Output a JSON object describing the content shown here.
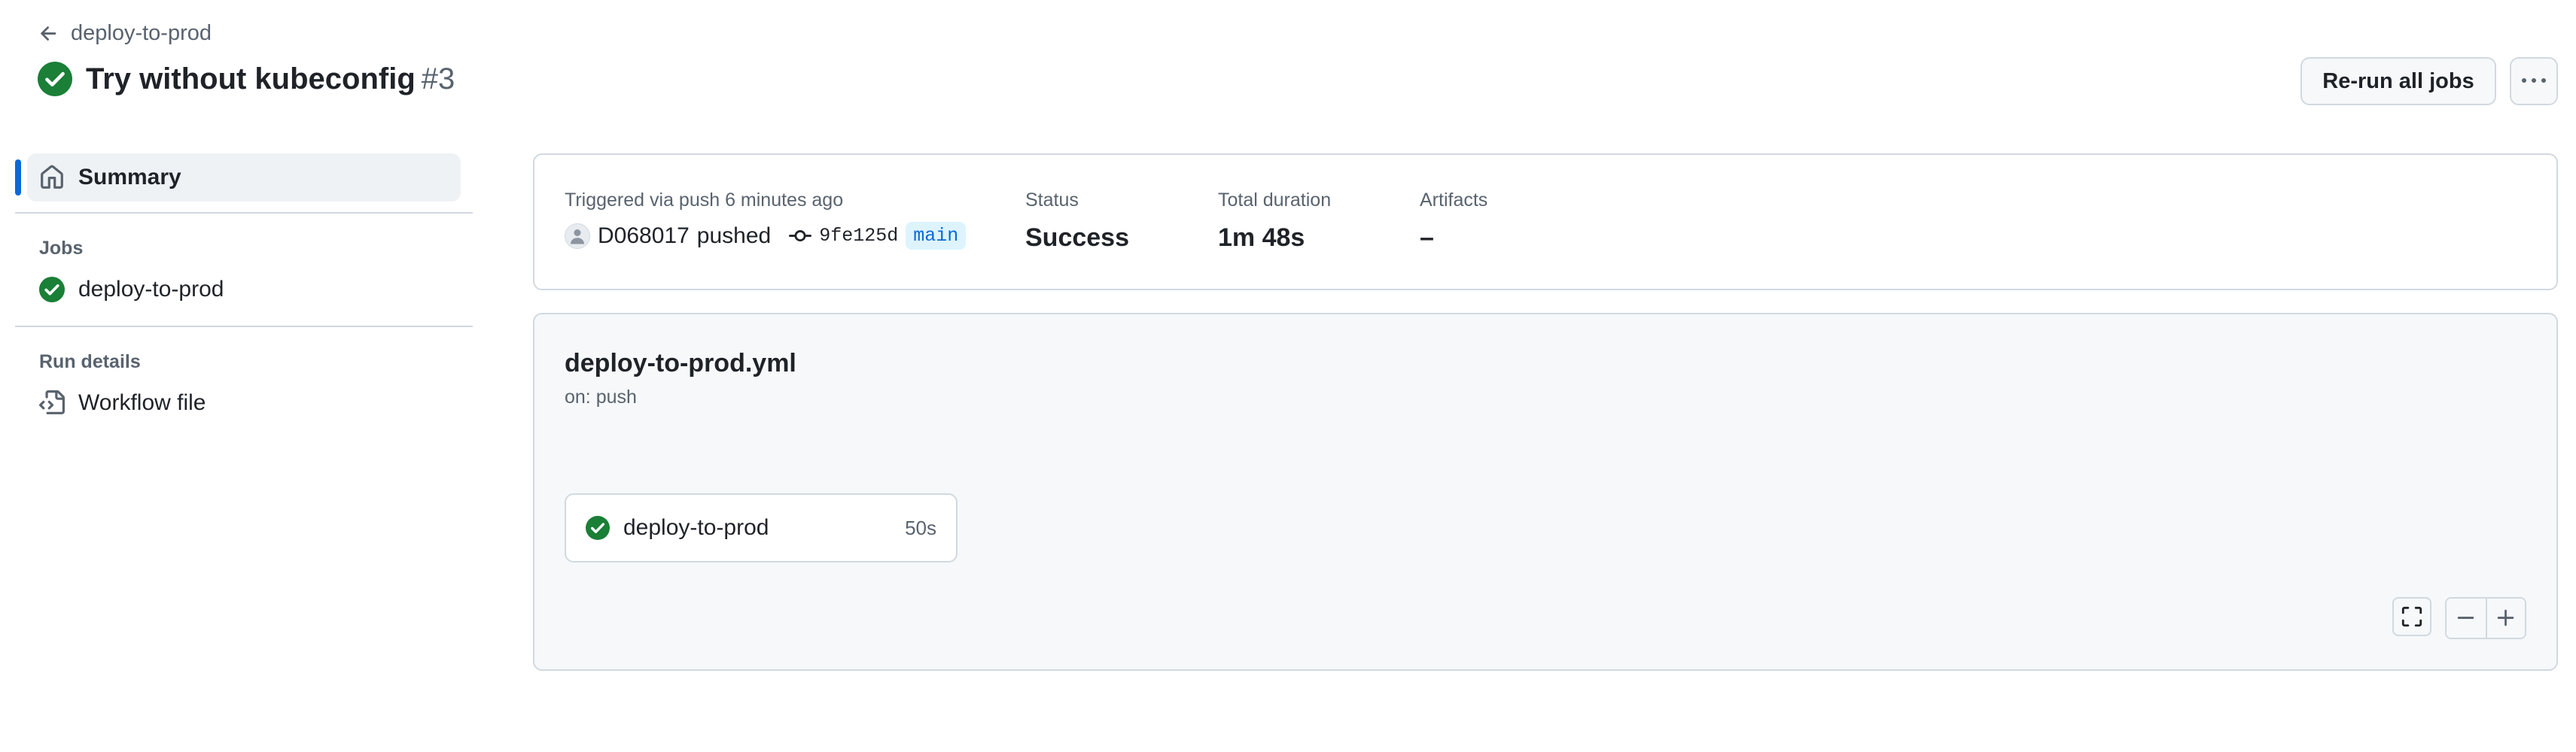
{
  "header": {
    "back_label": "deploy-to-prod",
    "run_title": "Try without kubeconfig",
    "run_number": "#3",
    "rerun_label": "Re-run all jobs"
  },
  "sidebar": {
    "summary_label": "Summary",
    "jobs_heading": "Jobs",
    "jobs": [
      {
        "label": "deploy-to-prod",
        "status": "success"
      }
    ],
    "run_details_heading": "Run details",
    "workflow_file_label": "Workflow file"
  },
  "summary": {
    "triggered_label": "Triggered via push 6 minutes ago",
    "actor": "D068017",
    "action": "pushed",
    "commit_sha": "9fe125d",
    "branch": "main",
    "status_label": "Status",
    "status_value": "Success",
    "duration_label": "Total duration",
    "duration_value": "1m 48s",
    "artifacts_label": "Artifacts",
    "artifacts_value": "–"
  },
  "workflow": {
    "filename": "deploy-to-prod.yml",
    "trigger": "on: push",
    "job": {
      "name": "deploy-to-prod",
      "duration": "50s",
      "status": "success"
    }
  },
  "colors": {
    "success": "#1a7f37",
    "accent": "#0969da",
    "border": "#d1d9e0",
    "muted_text": "#59636e"
  },
  "icons": {
    "back": "arrow-left-icon",
    "status": "check-circle-fill-icon",
    "summary": "home-icon",
    "workflow_file": "file-code-icon",
    "more": "kebab-horizontal-icon",
    "commit": "git-commit-icon",
    "fullscreen": "screen-full-icon",
    "zoom_out": "dash-icon",
    "zoom_in": "plus-icon"
  }
}
